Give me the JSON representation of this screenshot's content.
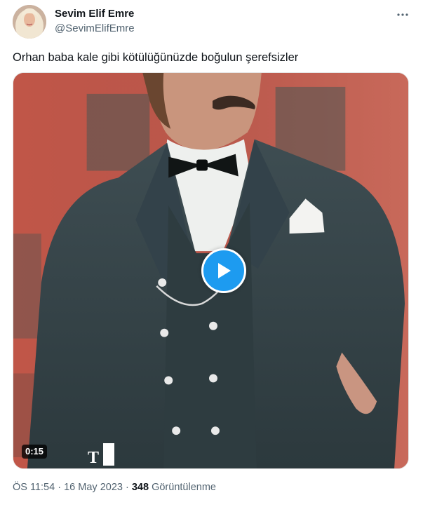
{
  "tweet": {
    "author": {
      "display_name": "Sevim Elif Emre",
      "handle": "@SevimElifEmre"
    },
    "text": "Orhan baba kale gibi kötülüğünüzde boğulun şerefsizler",
    "media": {
      "type": "video",
      "duration": "0:15",
      "watermark_letter": "T"
    },
    "time": "ÖS 11:54",
    "date": "16 May 2023",
    "separator": "·",
    "views_count": "348",
    "views_label": "Görüntülenme"
  },
  "colors": {
    "accent": "#1d9bf0",
    "text_primary": "#0f1419",
    "text_secondary": "#536471"
  },
  "icons": {
    "more": "more-horizontal-icon",
    "play": "play-icon"
  }
}
